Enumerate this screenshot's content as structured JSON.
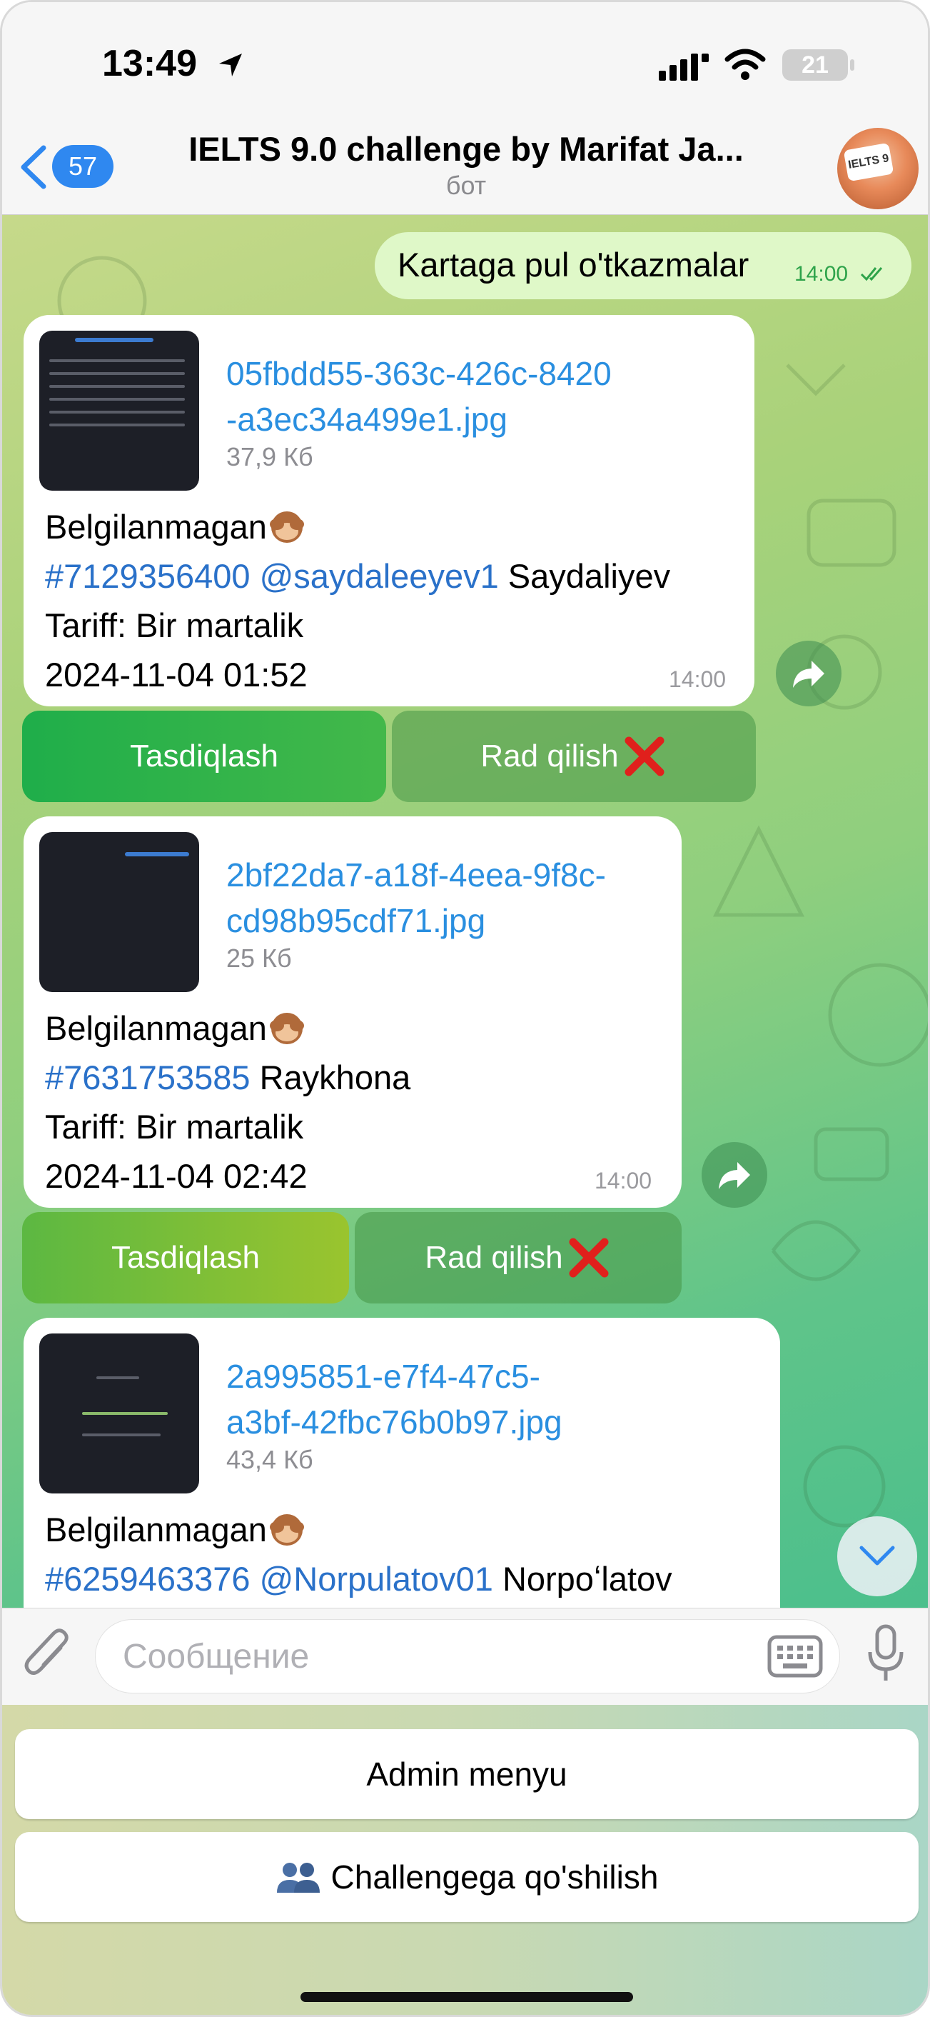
{
  "status_bar": {
    "time": "13:49",
    "battery": "21"
  },
  "header": {
    "back_count": "57",
    "title": "IELTS 9.0 challenge by Marifat Ja...",
    "subtitle": "бот",
    "avatar_text": "IELTS 9"
  },
  "outgoing": {
    "text": "Kartaga pul o'tkazmalar",
    "time": "14:00"
  },
  "messages": [
    {
      "file_name_1": "05fbdd55-363c-426c-8420",
      "file_name_2": "-a3ec34a499e1.jpg",
      "file_size": "37,9 Кб",
      "status": "Belgilanmagan",
      "id": "#7129356400",
      "username": "@saydaleeyev1",
      "name": "Saydaliyev",
      "tariff": "Tariff: Bir martalik",
      "datetime": "2024-11-04 01:52",
      "time": "14:00",
      "approve": "Tasdiqlash",
      "reject": "Rad qilish"
    },
    {
      "file_name_1": "2bf22da7-a18f-4eea-9f8c-",
      "file_name_2": "cd98b95cdf71.jpg",
      "file_size": "25 Кб",
      "status": "Belgilanmagan",
      "id": "#7631753585",
      "username": "",
      "name": "Raykhona",
      "tariff": "Tariff: Bir martalik",
      "datetime": "2024-11-04 02:42",
      "time": "14:00",
      "approve": "Tasdiqlash",
      "reject": "Rad qilish"
    },
    {
      "file_name_1": "2a995851-e7f4-47c5-",
      "file_name_2": "a3bf-42fbc76b0b97.jpg",
      "file_size": "43,4 Кб",
      "status": "Belgilanmagan",
      "id": "#6259463376",
      "username": "@Norpulatov01",
      "name": "Norpoʻlatov"
    }
  ],
  "input": {
    "placeholder": "Сообщение"
  },
  "reply_keyboard": {
    "admin_menu": "Admin menyu",
    "join_challenge": "Challengega qo'shilish"
  },
  "colors": {
    "accent": "#2f88f0",
    "link": "#2a71c9",
    "approve": "#1fae4a",
    "reject_mark": "#e0201c"
  }
}
